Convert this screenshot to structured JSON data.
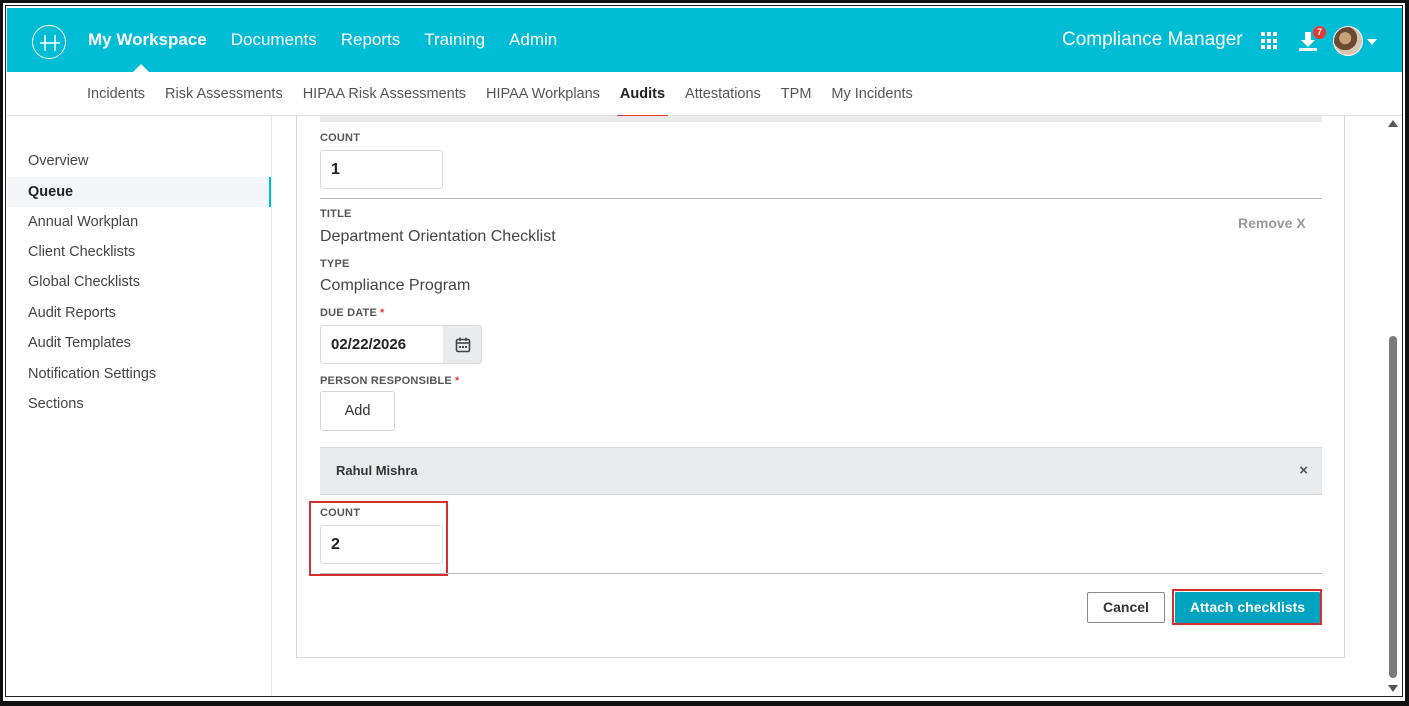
{
  "header": {
    "nav": [
      "My Workspace",
      "Documents",
      "Reports",
      "Training",
      "Admin"
    ],
    "app_name": "Compliance Manager",
    "notification_count": "7",
    "icons": [
      "logo-icon",
      "apps-grid-icon",
      "download-icon",
      "avatar",
      "chevron-down-icon"
    ]
  },
  "subnav": [
    "Incidents",
    "Risk Assessments",
    "HIPAA Risk Assessments",
    "HIPAA Workplans",
    "Audits",
    "Attestations",
    "TPM",
    "My Incidents"
  ],
  "sidebar": {
    "items": [
      "Overview",
      "Queue",
      "Annual Workplan",
      "Client Checklists",
      "Global Checklists",
      "Audit Reports",
      "Audit Templates",
      "Notification Settings",
      "Sections"
    ],
    "active": "Queue"
  },
  "form": {
    "first_count_label": "COUNT",
    "first_count_value": "1",
    "title_label": "TITLE",
    "title_value": "Department Orientation Checklist",
    "remove_label": "Remove X",
    "type_label": "TYPE",
    "type_value": "Compliance Program",
    "due_date_label": "DUE DATE",
    "due_date_value": "02/22/2026",
    "required_mark": "*",
    "person_label": "PERSON RESPONSIBLE",
    "add_label": "Add",
    "person_name": "Rahul Mishra",
    "person_remove": "×",
    "second_count_label": "COUNT",
    "second_count_value": "2"
  },
  "actions": {
    "cancel": "Cancel",
    "attach": "Attach checklists"
  },
  "colors": {
    "brand": "#00bcd4",
    "primary_button": "#00a3bf",
    "highlight": "#d32f2f"
  }
}
